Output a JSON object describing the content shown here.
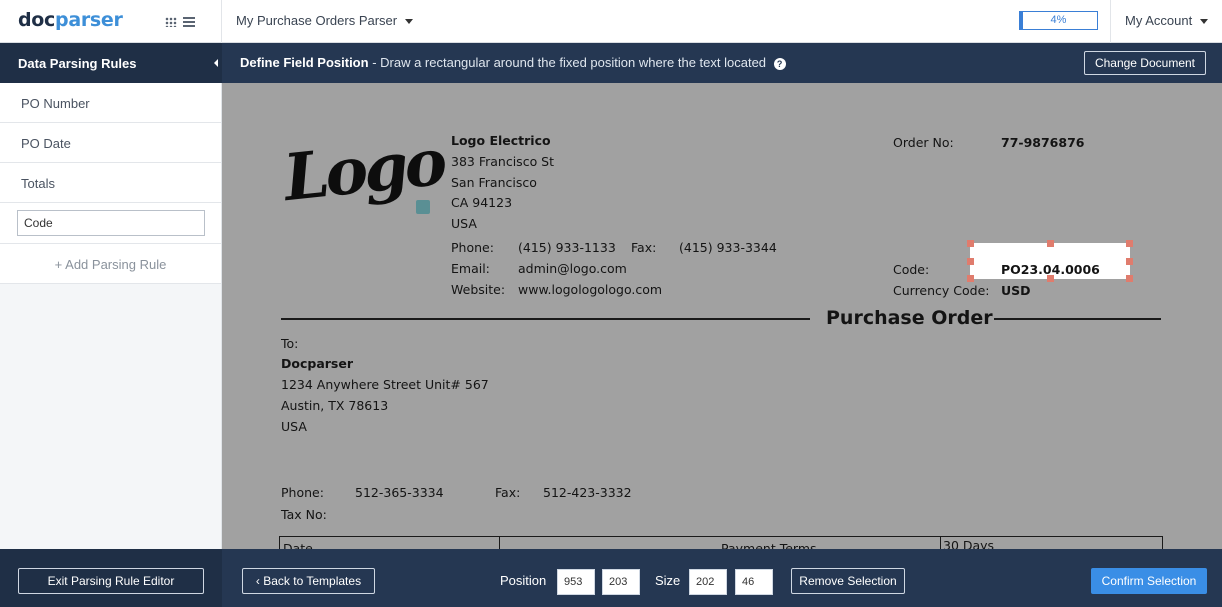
{
  "topbar": {
    "brand_pre": "doc",
    "brand_post": "parser",
    "parser_name": "My Purchase Orders Parser",
    "progress_label": "4%",
    "progress_value": 0.04,
    "account_label": "My Account"
  },
  "sidebar": {
    "header": "Data Parsing Rules",
    "rules": [
      "PO Number",
      "PO Date",
      "Totals"
    ],
    "edit_value": "Code",
    "add_rule": "+ Add Parsing Rule"
  },
  "main_header": {
    "title": "Define Field Position",
    "description": " - Draw a rectangular around the fixed position where the text located",
    "change_document": "Change Document"
  },
  "document": {
    "company": "Logo Electrico",
    "address1": "383 Francisco St",
    "address2": "San Francisco",
    "address3": "CA 94123",
    "address4": "USA",
    "phone_label": "Phone:",
    "phone": "(415) 933-1133",
    "fax_label": "Fax:",
    "fax": "(415) 933-3344",
    "email_label": "Email:",
    "email": "admin@logo.com",
    "website_label": "Website:",
    "website": "www.logologologo.com",
    "order_no_label": "Order No:",
    "order_no": "77-9876876",
    "code_label": "Code:",
    "code": "PO23.04.0006",
    "currency_label": "Currency Code:",
    "currency": "USD",
    "po_title": "Purchase Order",
    "to_label": "To:",
    "to_name": "Docparser",
    "to_address1": "1234 Anywhere Street Unit# 567",
    "to_address2": "Austin, TX 78613",
    "to_address3": "USA",
    "to_phone_label": "Phone:",
    "to_phone": "512-365-3334",
    "to_fax_label": "Fax:",
    "to_fax": "512-423-3332",
    "tax_label": "Tax No:",
    "table_cell1": "Date",
    "table_cell3": "Payment Terms",
    "table_cell4": "30 Days",
    "logo_text": "Logo"
  },
  "bottom": {
    "exit": "Exit Parsing Rule Editor",
    "back": "‹  Back to Templates",
    "position_label": "Position",
    "pos_x": "953",
    "pos_y": "203",
    "size_label": "Size",
    "size_w": "202",
    "size_h": "46",
    "remove": "Remove Selection",
    "confirm": "Confirm Selection"
  },
  "colors": {
    "navy": "#1f2f46",
    "header_navy": "#253752",
    "accent_blue": "#3a8ee6",
    "handle": "#e07c6d",
    "viewer_bg": "#a1a1a1"
  }
}
